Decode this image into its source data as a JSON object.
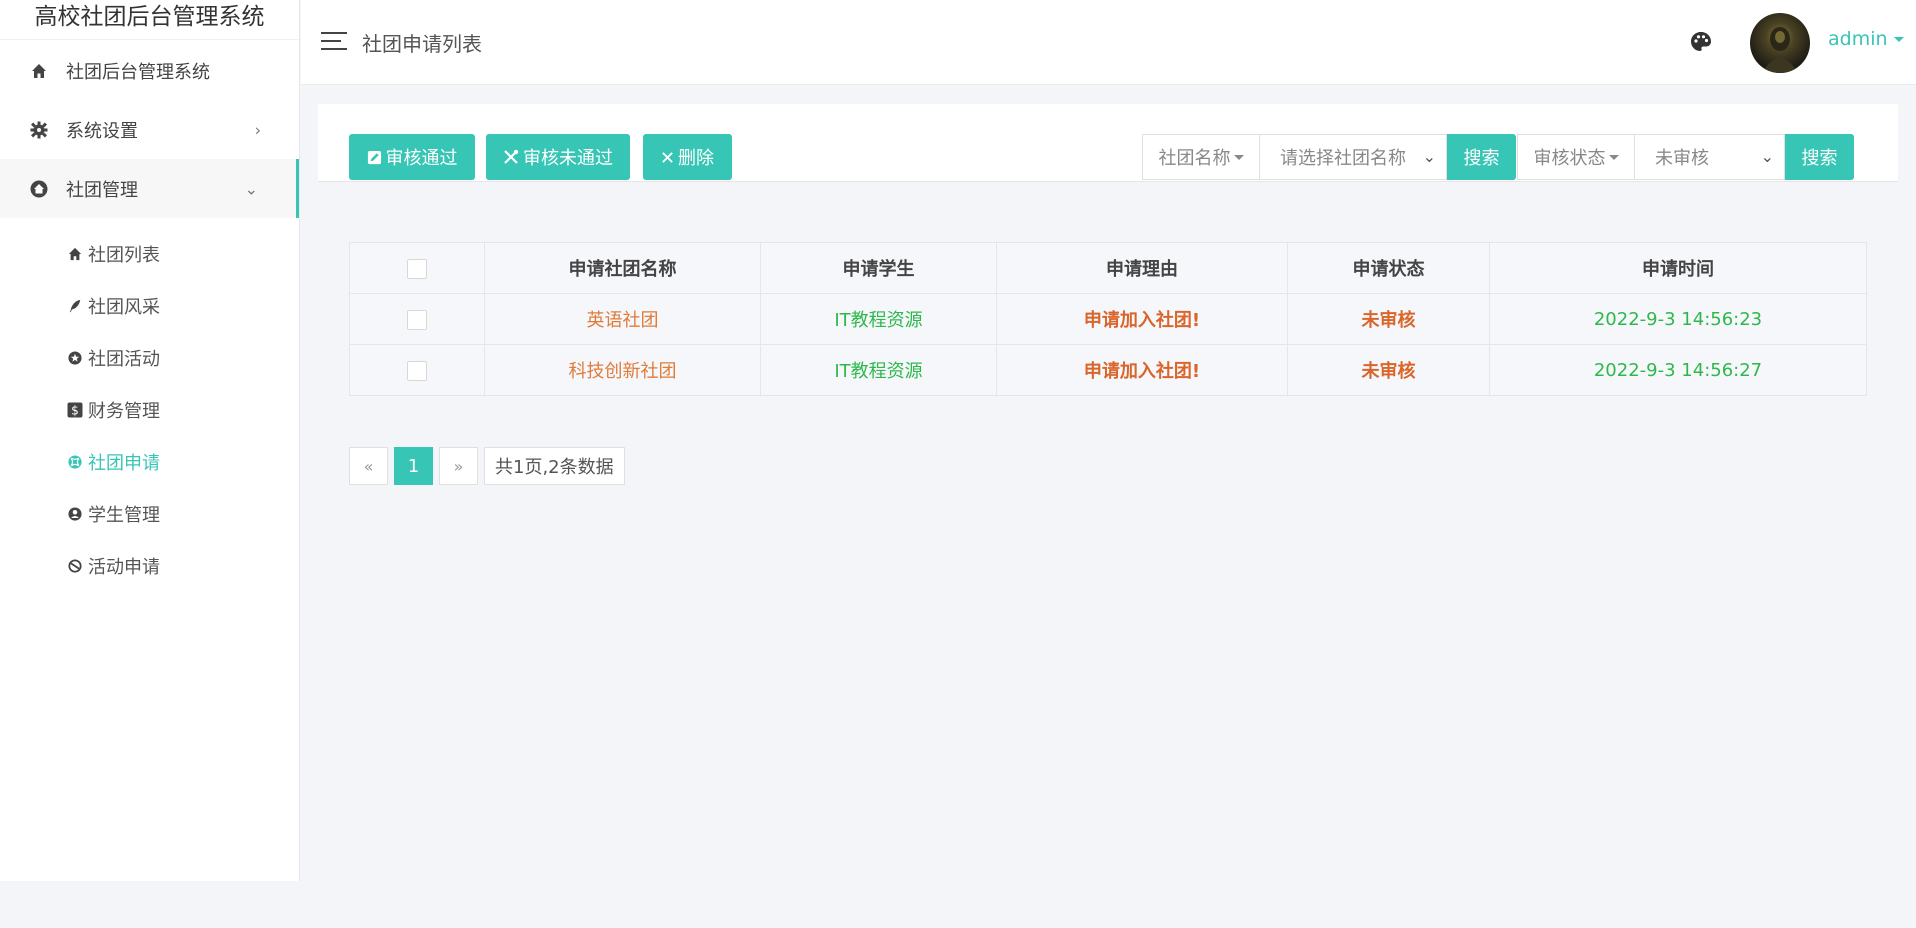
{
  "sidebar": {
    "brand": "高校社团后台管理系统",
    "items": [
      {
        "label": "社团后台管理系统",
        "icon": "home-icon"
      },
      {
        "label": "系统设置",
        "icon": "gear-icon",
        "chevron": "›"
      },
      {
        "label": "社团管理",
        "icon": "home-circle-icon",
        "chevron": "⌄"
      }
    ],
    "submenu": [
      {
        "label": "社团列表",
        "icon": "home-icon"
      },
      {
        "label": "社团风采",
        "icon": "feather-icon"
      },
      {
        "label": "社团活动",
        "icon": "star-circle-icon"
      },
      {
        "label": "财务管理",
        "icon": "dollar-icon"
      },
      {
        "label": "社团申请",
        "icon": "xbox-icon",
        "active": true
      },
      {
        "label": "学生管理",
        "icon": "user-circle-icon"
      },
      {
        "label": "活动申请",
        "icon": "ban-circle-icon"
      }
    ]
  },
  "header": {
    "title": "社团申请列表",
    "user": "admin"
  },
  "toolbar": {
    "approve_label": "审核通过",
    "reject_label": "审核未通过",
    "delete_label": "删除",
    "filter1_label": "社团名称",
    "filter1_placeholder": "请选择社团名称",
    "search1_label": "搜索",
    "filter2_label": "审核状态",
    "filter2_value": "未审核",
    "search2_label": "搜索"
  },
  "table": {
    "columns": [
      "申请社团名称",
      "申请学生",
      "申请理由",
      "申请状态",
      "申请时间"
    ],
    "rows": [
      {
        "club": "英语社团",
        "student": "IT教程资源",
        "reason": "申请加入社团!",
        "status": "未审核",
        "time": "2022-9-3 14:56:23"
      },
      {
        "club": "科技创新社团",
        "student": "IT教程资源",
        "reason": "申请加入社团!",
        "status": "未审核",
        "time": "2022-9-3 14:56:27"
      }
    ]
  },
  "pagination": {
    "prev": "«",
    "current": "1",
    "next": "»",
    "info": "共1页,2条数据"
  },
  "colors": {
    "accent": "#37c6b5",
    "orange": "#d9652a",
    "green": "#2eb84c"
  }
}
